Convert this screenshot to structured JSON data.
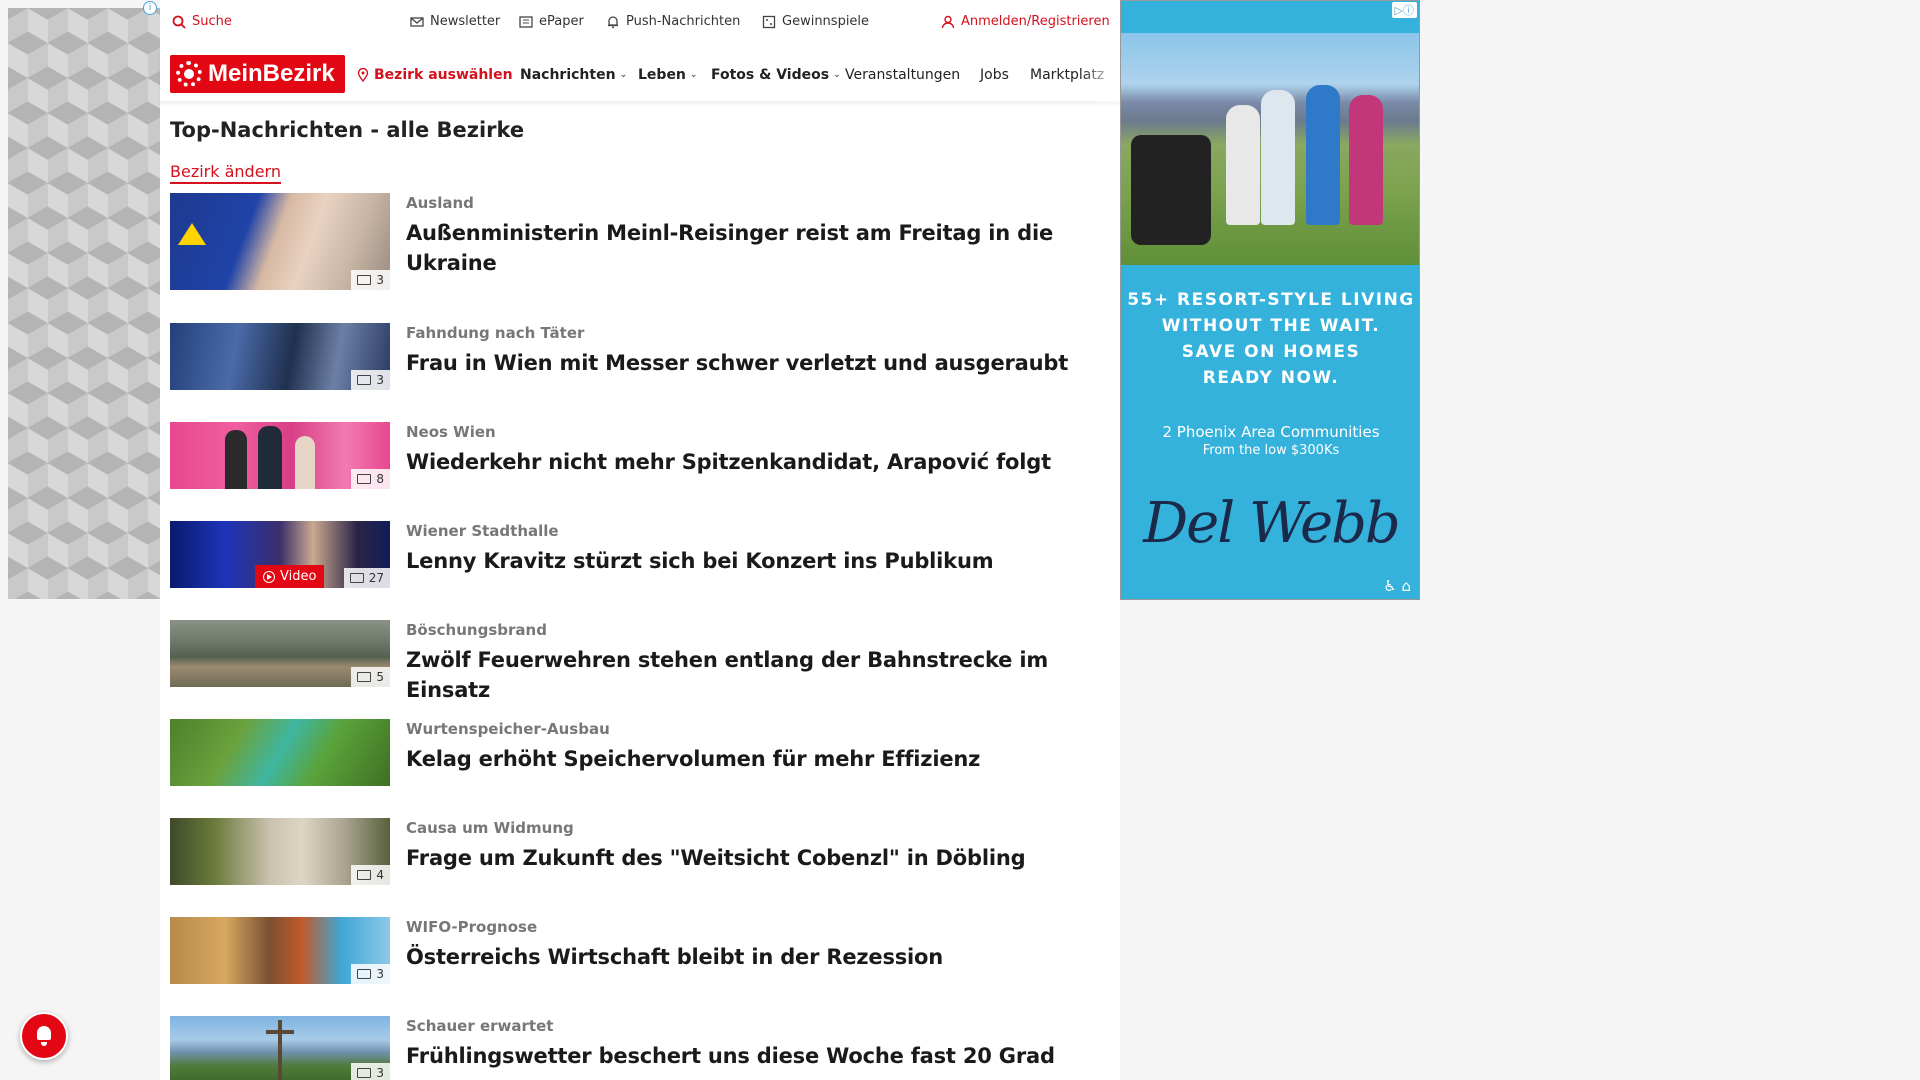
{
  "topbar": {
    "search": "Suche",
    "newsletter": "Newsletter",
    "epaper": "ePaper",
    "push": "Push-Nachrichten",
    "gewinnspiele": "Gewinnspiele",
    "login": "Anmelden/Registrieren"
  },
  "nav": {
    "logo": "MeinBezirk",
    "bezirk": "Bezirk auswählen",
    "items": [
      "Nachrichten",
      "Leben",
      "Fotos & Videos",
      "Veranstaltungen",
      "Jobs",
      "Marktplatz"
    ]
  },
  "section": {
    "title": "Top-Nachrichten - alle Bezirke",
    "change_link": "Bezirk ändern"
  },
  "articles": [
    {
      "kicker": "Ausland",
      "headline": "Außenministerin Meinl-Reisinger reist am Freitag in die Ukraine",
      "images": "3"
    },
    {
      "kicker": "Fahndung nach Täter",
      "headline": "Frau in Wien mit Messer schwer verletzt und ausgeraubt",
      "images": "3"
    },
    {
      "kicker": "Neos Wien",
      "headline": "Wiederkehr nicht mehr Spitzenkandidat, Arapović folgt",
      "images": "8"
    },
    {
      "kicker": "Wiener Stadthalle",
      "headline": "Lenny Kravitz stürzt sich bei Konzert ins Publikum",
      "images": "27",
      "video": "Video"
    },
    {
      "kicker": "Böschungsbrand",
      "headline": "Zwölf Feuerwehren stehen entlang der Bahnstrecke im Einsatz",
      "images": "5"
    },
    {
      "kicker": "Wurtenspeicher-Ausbau",
      "headline": "Kelag erhöht Speichervolumen für mehr Effizienz",
      "images": ""
    },
    {
      "kicker": "Causa um Widmung",
      "headline": "Frage um Zukunft des \"Weitsicht Cobenzl\" in Döbling",
      "images": "4"
    },
    {
      "kicker": "WIFO-Prognose",
      "headline": "Österreichs Wirtschaft bleibt in der Rezession",
      "images": "3"
    },
    {
      "kicker": "Schauer erwartet",
      "headline": "Frühlingswetter beschert uns diese Woche fast 20 Grad",
      "images": "3"
    }
  ],
  "ad": {
    "headline_lines": [
      "55+ RESORT-STYLE LIVING",
      "WITHOUT THE WAIT.",
      "SAVE ON HOMES",
      "READY NOW."
    ],
    "sub": "2 Phoenix Area Communities",
    "sub2": "From the low $300Ks",
    "brand": "Del Webb"
  },
  "colors": {
    "accent": "#e30613",
    "ad_bg": "#35b2db"
  },
  "icons": [
    "search-icon",
    "mail-icon",
    "epaper-icon",
    "bell-icon",
    "gift-icon",
    "user-icon",
    "location-pin-icon",
    "chevron-down-icon",
    "image-count-icon",
    "play-icon",
    "notification-bell-icon"
  ]
}
